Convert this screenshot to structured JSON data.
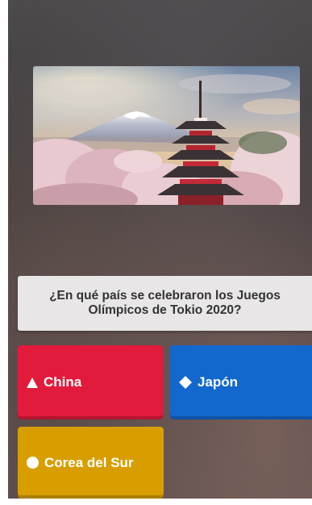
{
  "question": {
    "text": "¿En qué país se celebraron los Juegos Olímpicos de Tokio 2020?",
    "image": {
      "subject": "Chureito Pagoda with Mount Fuji and cherry blossoms"
    }
  },
  "answers": [
    {
      "label": "China",
      "shape": "triangle-icon",
      "color": "#e21b3c"
    },
    {
      "label": "Japón",
      "shape": "diamond-icon",
      "color": "#1368ce"
    },
    {
      "label": "Corea del Sur",
      "shape": "circle-icon",
      "color": "#d89e00"
    }
  ],
  "colors": {
    "background": "#4a4446",
    "question_box": "#e8e6e6",
    "question_text": "#333333"
  }
}
